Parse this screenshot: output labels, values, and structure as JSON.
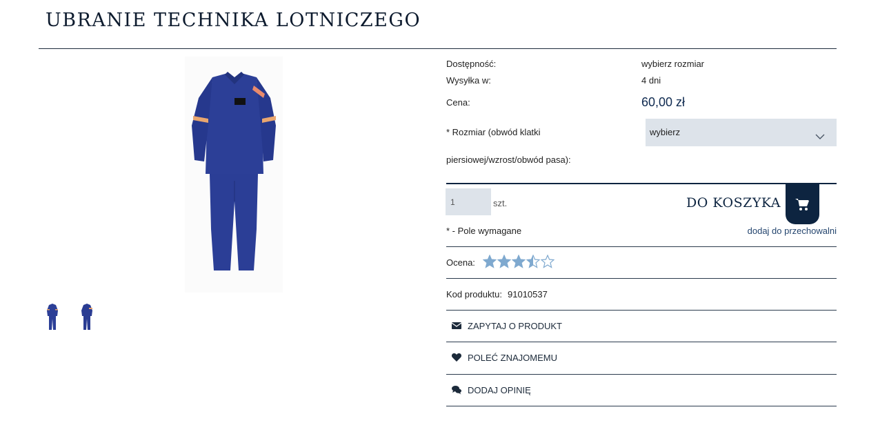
{
  "product": {
    "title": "UBRANIE TECHNIKA LOTNICZEGO",
    "availability_label": "Dostępność:",
    "availability_value": "wybierz rozmiar",
    "shipping_label": "Wysyłka w:",
    "shipping_value": "4 dni",
    "price_label": "Cena:",
    "price_value": "60,00 zł",
    "size_label_line1": "* Rozmiar (obwód klatki",
    "size_label_line2": "piersiowej/wzrost/obwód pasa):",
    "size_selected": "wybierz",
    "quantity_value": "1",
    "quantity_unit": "szt.",
    "add_to_cart_label": "DO KOSZYKA",
    "required_note": "* - Pole wymagane",
    "wishlist_link": "dodaj do przechowalni",
    "rating_label": "Ocena:",
    "rating_value": 3.5,
    "rating_max": 5,
    "code_label": "Kod produktu:",
    "code_value": "91010537"
  },
  "actions": {
    "ask": "ZAPYTAJ O PRODUKT",
    "recommend": "POLEĆ ZNAJOMEMU",
    "review": "DODAJ OPINIĘ"
  },
  "colors": {
    "accent_dark": "#0d2440",
    "star": "#7fa9cf",
    "select_bg": "#dde3ea"
  }
}
